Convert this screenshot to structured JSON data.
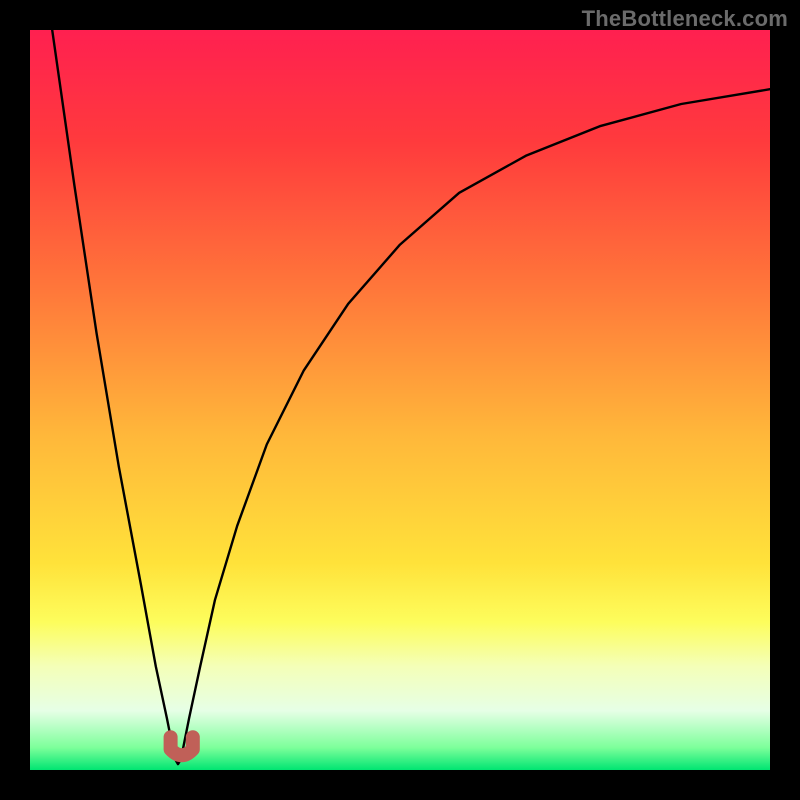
{
  "watermark": "TheBottleneck.com",
  "chart_data": {
    "type": "line",
    "title": "",
    "xlabel": "",
    "ylabel": "",
    "xlim": [
      0,
      100
    ],
    "ylim": [
      0,
      100
    ],
    "grid": false,
    "legend": false,
    "background": {
      "type": "vertical-gradient",
      "stops": [
        {
          "pos": 0.0,
          "color": "#ff2050"
        },
        {
          "pos": 0.15,
          "color": "#ff3a3d"
        },
        {
          "pos": 0.35,
          "color": "#ff773a"
        },
        {
          "pos": 0.55,
          "color": "#ffb83a"
        },
        {
          "pos": 0.72,
          "color": "#ffe23a"
        },
        {
          "pos": 0.8,
          "color": "#fdfd5c"
        },
        {
          "pos": 0.86,
          "color": "#f4ffb8"
        },
        {
          "pos": 0.92,
          "color": "#e6ffe6"
        },
        {
          "pos": 0.97,
          "color": "#7cff9a"
        },
        {
          "pos": 1.0,
          "color": "#00e572"
        }
      ]
    },
    "series": [
      {
        "name": "bottleneck-curve",
        "color": "#000000",
        "x": [
          3,
          6,
          9,
          12,
          15,
          17,
          18.5,
          19.3,
          19.7,
          20,
          20.3,
          20.7,
          21.5,
          23,
          25,
          28,
          32,
          37,
          43,
          50,
          58,
          67,
          77,
          88,
          100
        ],
        "y": [
          100,
          79,
          59,
          41,
          25,
          14,
          7,
          3,
          1.3,
          0.8,
          1.3,
          3,
          7,
          14,
          23,
          33,
          44,
          54,
          63,
          71,
          78,
          83,
          87,
          90,
          92
        ]
      }
    ],
    "markers": [
      {
        "name": "vertex-marker",
        "shape": "u",
        "color": "#c06058",
        "x_range": [
          19,
          22
        ],
        "y": 2
      }
    ]
  }
}
